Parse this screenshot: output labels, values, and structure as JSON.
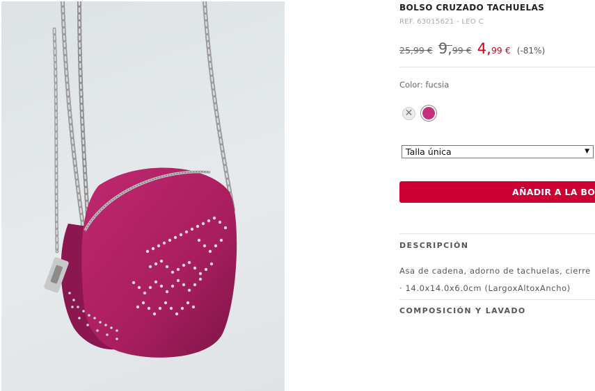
{
  "product": {
    "name": "BOLSO CRUZADO TACHUELAS",
    "ref": "REF. 63015621 - LEO C",
    "image_description_icon": "product-photo"
  },
  "prices": {
    "original": "25,99 €",
    "previous_int": "9,",
    "previous_dec": "99 €",
    "current_int": "4,",
    "current_dec": "99 €",
    "discount": "(-81%)",
    "sale_color": "#d0021b"
  },
  "color": {
    "label": "Color: fucsia",
    "swatches": [
      {
        "name": "unavailable",
        "icon": "x-icon",
        "glyph": "✕"
      },
      {
        "name": "fucsia",
        "hex": "#c62f7e"
      }
    ]
  },
  "size": {
    "selected": "Talla única",
    "arrow": "▼"
  },
  "add_to_bag": {
    "label": "AÑADIR A LA BOLSA",
    "color": "#cc0033"
  },
  "description": {
    "heading": "DESCRIPCIÓN",
    "line1": "Asa de cadena, adorno de tachuelas, cierre",
    "line2": "· 14.0x14.0x6.0cm (LargoxAltoxAncho)"
  },
  "composition": {
    "heading": "COMPOSICIÓN Y LAVADO"
  }
}
